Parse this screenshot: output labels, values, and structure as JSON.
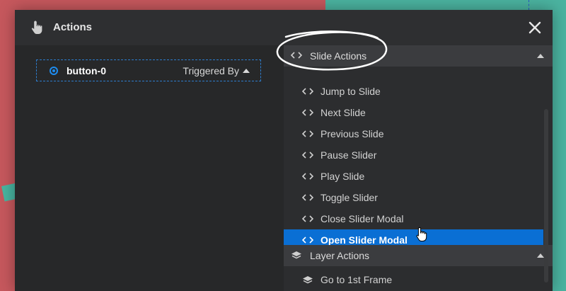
{
  "modal": {
    "title": "Actions",
    "close_glyph": "✕"
  },
  "trigger": {
    "button_label": "button-0",
    "triggered_by_label": "Triggered By"
  },
  "slide_actions": {
    "header": "Slide Actions",
    "items": [
      {
        "label": "Jump to Slide"
      },
      {
        "label": "Next Slide"
      },
      {
        "label": "Previous Slide"
      },
      {
        "label": "Pause Slider"
      },
      {
        "label": "Play Slide"
      },
      {
        "label": "Toggle Slider"
      },
      {
        "label": "Close Slider Modal"
      },
      {
        "label": "Open Slider Modal",
        "active": true
      }
    ]
  },
  "layer_actions": {
    "header": "Layer Actions",
    "items": [
      {
        "label": "Go to 1st Frame"
      }
    ]
  },
  "icons": {
    "code": "code-brackets-icon",
    "layers": "layers-icon",
    "hand": "hand-pointer-icon",
    "close": "close-icon"
  },
  "colors": {
    "accent": "#0a6fd4",
    "radio": "#1d8cf0",
    "modal_bg": "#272829",
    "panel_bg": "#2c2d2f"
  }
}
